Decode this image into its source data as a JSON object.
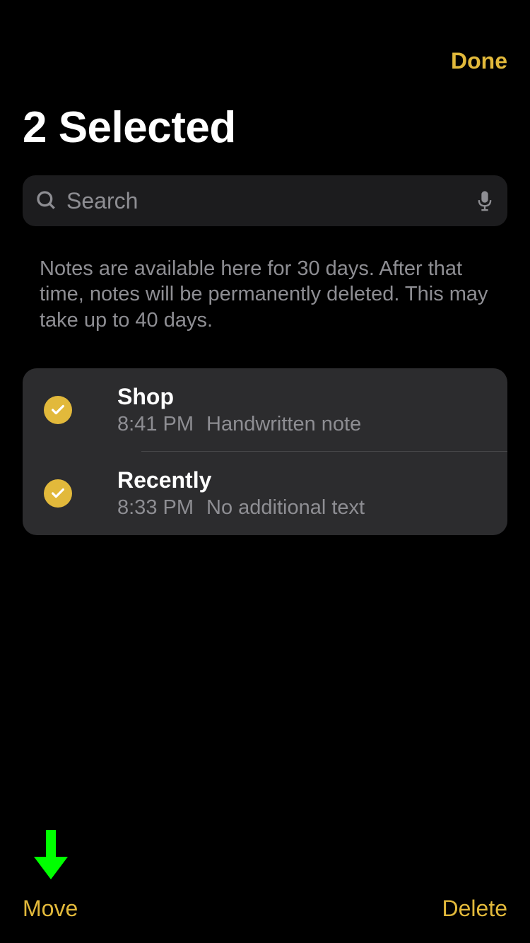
{
  "header": {
    "done_label": "Done"
  },
  "title": "2 Selected",
  "search": {
    "placeholder": "Search"
  },
  "info_text": "Notes are available here for 30 days. After that time, notes will be permanently deleted. This may take up to 40 days.",
  "notes": [
    {
      "title": "Shop",
      "time": "8:41 PM",
      "preview": "Handwritten note",
      "selected": true
    },
    {
      "title": "Recently",
      "time": "8:33 PM",
      "preview": "No additional text",
      "selected": true
    }
  ],
  "toolbar": {
    "move_label": "Move",
    "delete_label": "Delete"
  },
  "colors": {
    "accent": "#e2b93b",
    "background": "#000000",
    "card": "#2c2c2e",
    "search_bg": "#1c1c1e",
    "secondary_text": "#8e8e93",
    "arrow": "#00ff00"
  }
}
